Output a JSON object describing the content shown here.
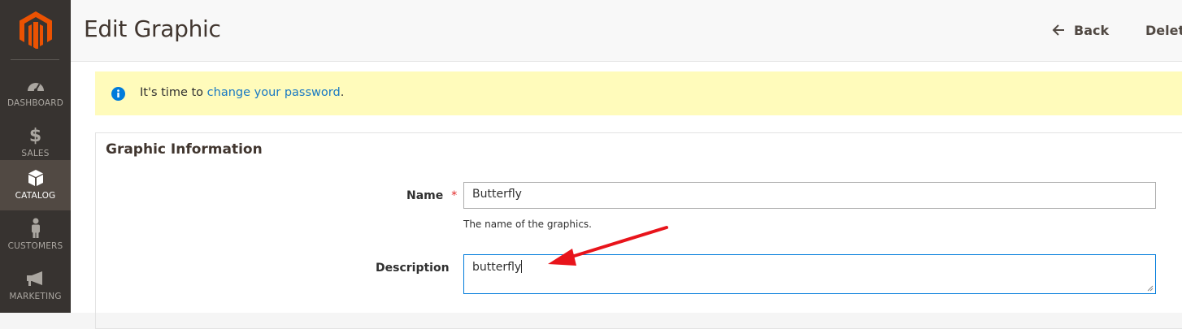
{
  "sidebar": {
    "logo": "magento-logo",
    "items": [
      {
        "label": "DASHBOARD",
        "icon": "dashboard-gauge-icon",
        "active": false
      },
      {
        "label": "SALES",
        "icon": "dollar-icon",
        "active": false
      },
      {
        "label": "CATALOG",
        "icon": "cube-icon",
        "active": true
      },
      {
        "label": "CUSTOMERS",
        "icon": "person-icon",
        "active": false
      },
      {
        "label": "MARKETING",
        "icon": "megaphone-icon",
        "active": false
      }
    ]
  },
  "header": {
    "title": "Edit Graphic",
    "back_label": "Back",
    "delete_label": "Delete"
  },
  "notice": {
    "prefix": "It's time to ",
    "link": "change your password",
    "suffix": "."
  },
  "form": {
    "section_title": "Graphic Information",
    "name": {
      "label": "Name",
      "required_mark": "*",
      "value": "Butterfly",
      "note": "The name of the graphics."
    },
    "description": {
      "label": "Description",
      "value": "butterfly"
    }
  },
  "colors": {
    "sidebar_bg": "#373330",
    "sidebar_active": "#514943",
    "brand_orange": "#eb5202",
    "link": "#1979c3",
    "notice_bg": "#fffbbb",
    "annotation_arrow": "#e8141b"
  }
}
